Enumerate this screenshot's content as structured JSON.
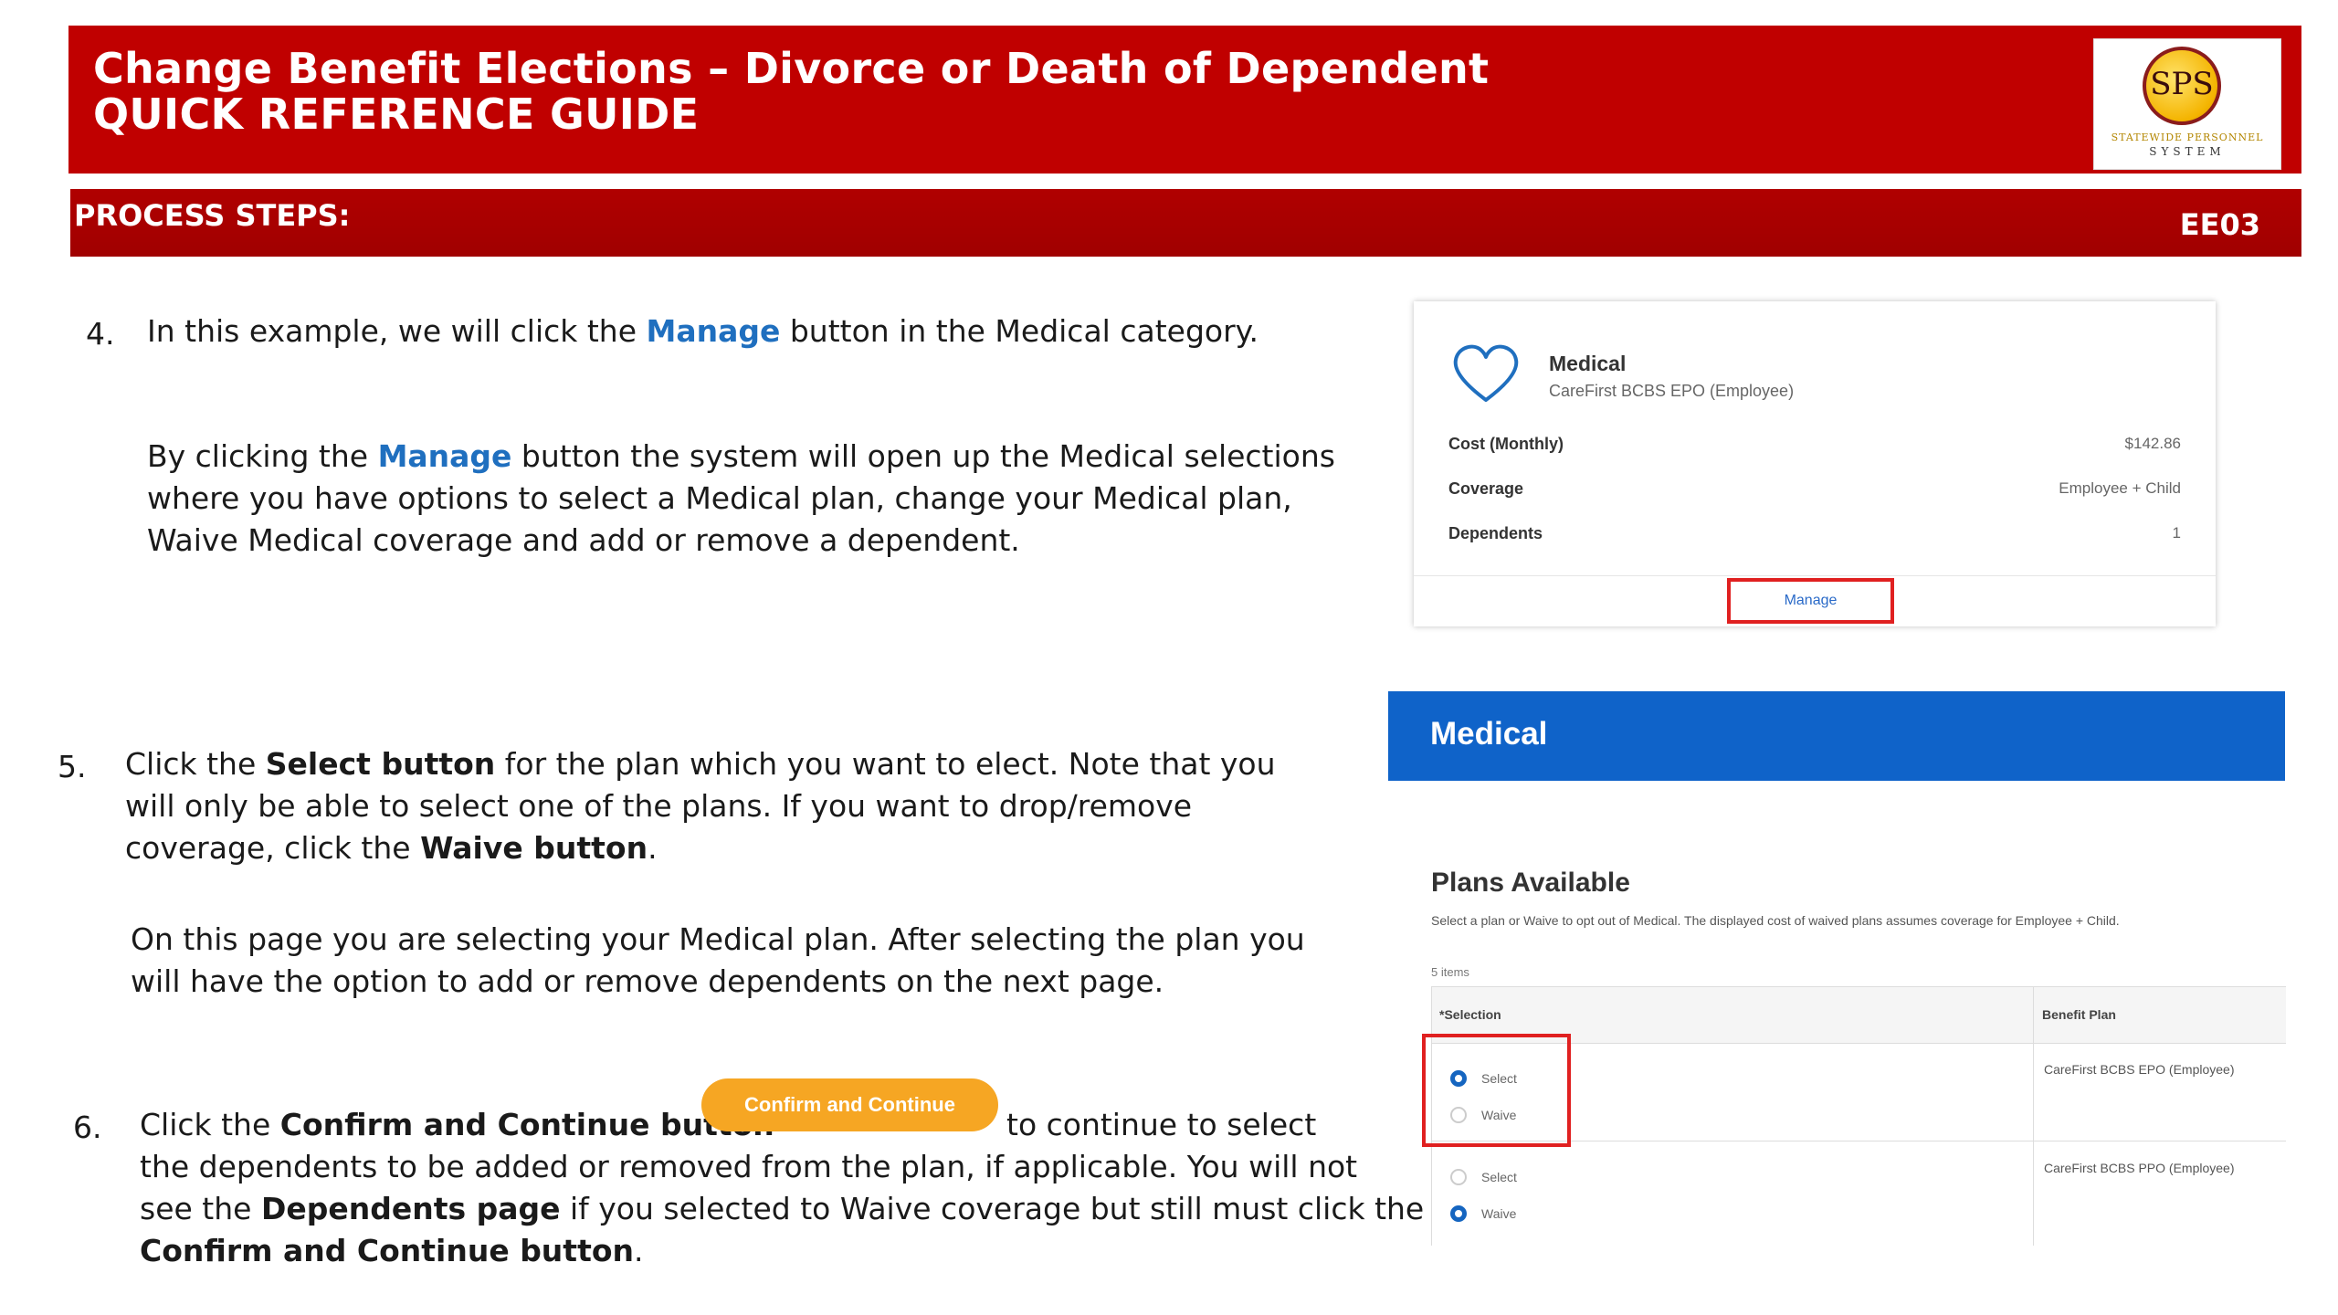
{
  "header": {
    "title": "Change Benefit Elections – Divorce or Death of Dependent",
    "subtitle": "QUICK REFERENCE GUIDE",
    "logo": {
      "letters": "SPS",
      "line1": "STATEWIDE PERSONNEL",
      "line2": "SYSTEM"
    }
  },
  "steps_bar": {
    "label": "PROCESS STEPS:",
    "code": "EE03"
  },
  "step4": {
    "number": "4.",
    "line1_a": "In this example, we will click the ",
    "line1_b": "Manage",
    "line1_c": " button in the Medical category.",
    "p2_a": "By clicking the ",
    "p2_b": "Manage",
    "p2_c": " button the system will open up the Medical selections",
    "p2_line2": "where you have options to select a Medical plan, change your Medical plan,",
    "p2_line3": "Waive Medical coverage and add or remove a dependent."
  },
  "step5": {
    "number": "5.",
    "l1_a": "Click the ",
    "l1_b": "Select button",
    "l1_c": " for the plan which you want to elect. Note that you",
    "l2": "will only be able to select one of the plans. If you want to drop/remove",
    "l3_a": "coverage, click the ",
    "l3_b": "Waive button",
    "l3_c": ".",
    "p2_l1": "On this page you are selecting your Medical plan.  After selecting the plan you",
    "p2_l2": "will have the option to add or remove dependents on the next page."
  },
  "step6": {
    "number": "6.",
    "l1_a": "Click the ",
    "l1_b": "Confirm and Continue button",
    "button_label": "Confirm and Continue",
    "l1_c": "to continue to select",
    "l2": "the dependents to be added or removed from the plan, if applicable. You will not",
    "l3_a": "see the ",
    "l3_b": "Dependents page",
    "l3_c": " if you selected to Waive coverage but still must click the",
    "l4_b": "Confirm and Continue button",
    "l4_c": "."
  },
  "medical_card": {
    "icon": "heart-icon",
    "title": "Medical",
    "plan": "CareFirst BCBS EPO (Employee)",
    "rows": [
      {
        "label": "Cost (Monthly)",
        "value": "$142.86"
      },
      {
        "label": "Coverage",
        "value": "Employee + Child"
      },
      {
        "label": "Dependents",
        "value": "1"
      }
    ],
    "manage_label": "Manage"
  },
  "medical_page": {
    "header": "Medical",
    "plans_title": "Plans Available",
    "description": "Select a plan or Waive to opt out of Medical. The displayed cost of waived plans assumes coverage for Employee + Child.",
    "items_count": "5 items",
    "col_selection": "*Selection",
    "col_plan": "Benefit Plan",
    "rows": [
      {
        "select_label": "Select",
        "waive_label": "Waive",
        "selected": "select",
        "plan": "CareFirst BCBS EPO (Employee)"
      },
      {
        "select_label": "Select",
        "waive_label": "Waive",
        "selected": "waive",
        "plan": "CareFirst BCBS PPO (Employee)"
      }
    ]
  },
  "colors": {
    "banner": "#c00000",
    "steps_bar": "#a00000",
    "link": "#1f6fbf",
    "medical_bar": "#0f63c9",
    "confirm": "#f6a623",
    "highlight": "#e02020"
  }
}
